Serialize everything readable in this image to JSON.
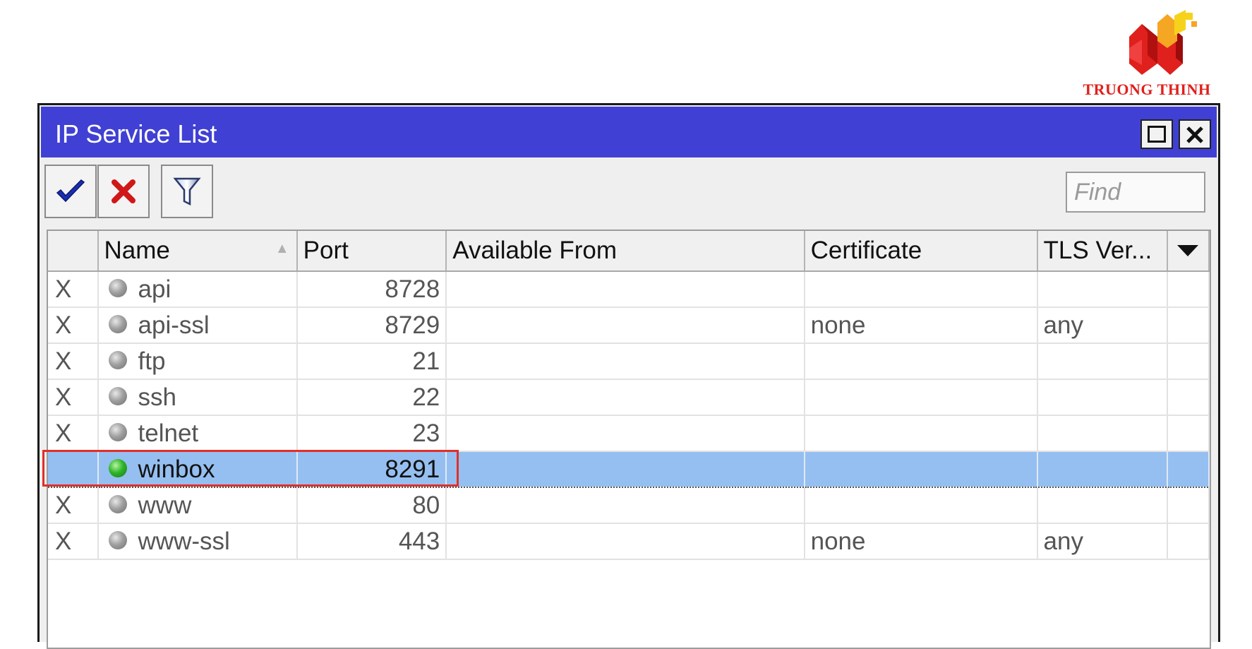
{
  "logo": {
    "text": "TRUONG THINH"
  },
  "window": {
    "title": "IP Service List"
  },
  "toolbar": {
    "enable_icon": "checkmark-icon",
    "disable_icon": "x-icon",
    "filter_icon": "filter-icon",
    "find_placeholder": "Find"
  },
  "table": {
    "columns": [
      "",
      "Name",
      "Port",
      "Available From",
      "Certificate",
      "TLS Ver..."
    ],
    "rows": [
      {
        "flag": "X",
        "name": "api",
        "port": "8728",
        "available_from": "",
        "certificate": "",
        "tls": ""
      },
      {
        "flag": "X",
        "name": "api-ssl",
        "port": "8729",
        "available_from": "",
        "certificate": "none",
        "tls": "any"
      },
      {
        "flag": "X",
        "name": "ftp",
        "port": "21",
        "available_from": "",
        "certificate": "",
        "tls": ""
      },
      {
        "flag": "X",
        "name": "ssh",
        "port": "22",
        "available_from": "",
        "certificate": "",
        "tls": ""
      },
      {
        "flag": "X",
        "name": "telnet",
        "port": "23",
        "available_from": "",
        "certificate": "",
        "tls": ""
      },
      {
        "flag": "",
        "name": "winbox",
        "port": "8291",
        "available_from": "",
        "certificate": "",
        "tls": ""
      },
      {
        "flag": "X",
        "name": "www",
        "port": "80",
        "available_from": "",
        "certificate": "",
        "tls": ""
      },
      {
        "flag": "X",
        "name": "www-ssl",
        "port": "443",
        "available_from": "",
        "certificate": "none",
        "tls": "any"
      }
    ],
    "selected_row": "winbox"
  },
  "colors": {
    "titlebar": "#4040d4",
    "selection": "#95bff0",
    "highlight": "#e0302a"
  }
}
